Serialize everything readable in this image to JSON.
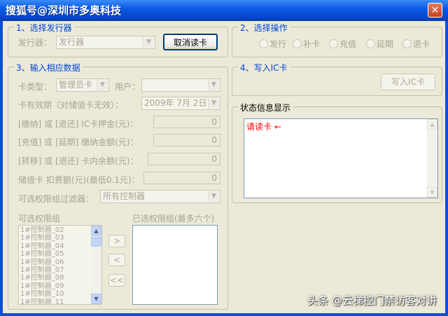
{
  "window": {
    "title": "搜狐号@深圳市多奥科技",
    "close_glyph": "✕"
  },
  "issuer_group": {
    "title": "1、选择发行器",
    "issuer_label": "发行器：",
    "issuer_value": "发行器",
    "cancel_read_button": "取消读卡"
  },
  "operation_group": {
    "title": "2、选择操作",
    "options": [
      "发行",
      "补卡",
      "充值",
      "延期",
      "退卡"
    ]
  },
  "data_group": {
    "title": "3、输入相应数据",
    "card_type_label": "卡类型：",
    "card_type_value": "管理员卡",
    "user_label": "用户：",
    "user_value": "",
    "validity_label": "卡有效期（对储值卡无效）：",
    "validity_value": "2009年 7月 2日",
    "deposit_label": "[缴纳] 或 [退还] IC卡押金(元)：",
    "deposit_value": "0",
    "recharge_label": "[充值] 或 [延期] 缴纳金额(元)：",
    "recharge_value": "0",
    "transfer_label": "[转移] 或 [退还] 卡内余额(元)：",
    "transfer_value": "0",
    "fee_label": "储值卡 扣费额(元)(最低0.1元)：",
    "fee_value": "0",
    "filter_label": "可选权限组过滤器：",
    "filter_value": "所有控制器",
    "available_groups_label": "可选权限组",
    "selected_groups_label": "已选权限组(最多六个)",
    "available_groups": [
      "1#控制器_02",
      "1#控制器_03",
      "1#控制器_04",
      "1#控制器_05",
      "1#控制器_06",
      "1#控制器_07",
      "1#控制器_08",
      "1#控制器_09",
      "1#控制器_10",
      "1#控制器_11"
    ],
    "add_button": ">",
    "remove_button": "<",
    "remove_all_button": "<<"
  },
  "write_group": {
    "title": "4、写入IC卡",
    "write_button": "写入IC卡"
  },
  "status_group": {
    "title": "状态信息显示",
    "message": "请读卡 ←"
  },
  "watermark": "头条 @云梯控门禁访客对讲"
}
